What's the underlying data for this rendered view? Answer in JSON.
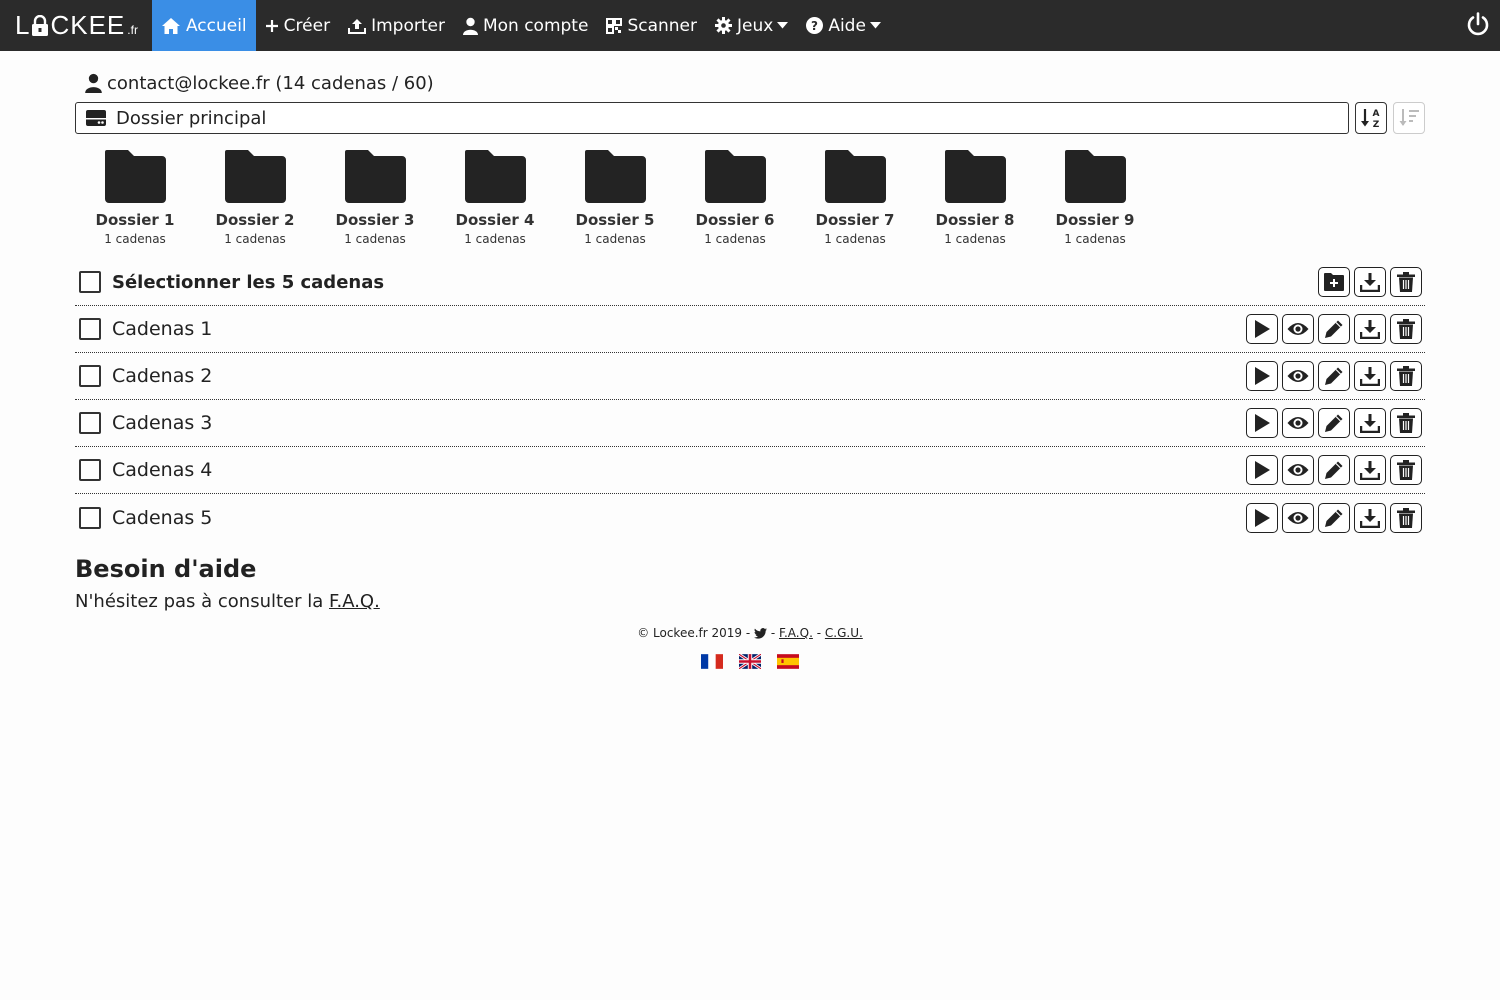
{
  "brand": {
    "logo_pre": "L",
    "logo_post": "CKEE",
    "tld": ".fr"
  },
  "nav": {
    "home": "Accueil",
    "create": "Créer",
    "import": "Importer",
    "account": "Mon compte",
    "scanner": "Scanner",
    "games": "Jeux",
    "help": "Aide"
  },
  "account": {
    "text": "contact@lockee.fr (14 cadenas / 60)"
  },
  "folder_select": {
    "value": "Dossier principal"
  },
  "folders": [
    {
      "name": "Dossier 1",
      "count": "1 cadenas"
    },
    {
      "name": "Dossier 2",
      "count": "1 cadenas"
    },
    {
      "name": "Dossier 3",
      "count": "1 cadenas"
    },
    {
      "name": "Dossier 4",
      "count": "1 cadenas"
    },
    {
      "name": "Dossier 5",
      "count": "1 cadenas"
    },
    {
      "name": "Dossier 6",
      "count": "1 cadenas"
    },
    {
      "name": "Dossier 7",
      "count": "1 cadenas"
    },
    {
      "name": "Dossier 8",
      "count": "1 cadenas"
    },
    {
      "name": "Dossier 9",
      "count": "1 cadenas"
    }
  ],
  "select_all": {
    "label": "Sélectionner les 5 cadenas"
  },
  "locks": [
    {
      "name": "Cadenas 1"
    },
    {
      "name": "Cadenas 2"
    },
    {
      "name": "Cadenas 3"
    },
    {
      "name": "Cadenas 4"
    },
    {
      "name": "Cadenas 5"
    }
  ],
  "help": {
    "title": "Besoin d'aide",
    "text": "N'hésitez pas à consulter la",
    "link": "F.A.Q."
  },
  "footer": {
    "copyright": "© Lockee.fr 2019 -",
    "sep1": "-",
    "faq": "F.A.Q.",
    "sep2": "-",
    "cgu": "C.G.U."
  },
  "colors": {
    "navbar": "#2b2b2b",
    "active": "#3a8ee6"
  }
}
